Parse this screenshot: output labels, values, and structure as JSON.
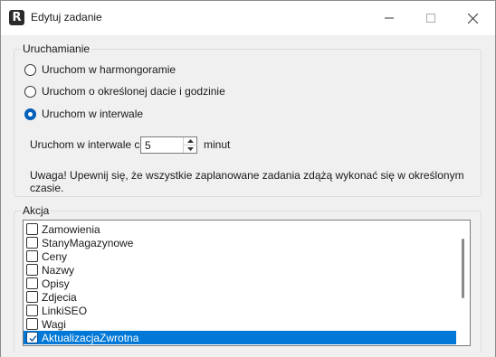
{
  "window": {
    "title": "Edytuj zadanie",
    "app_icon_letter": "R"
  },
  "launch_group": {
    "legend": "Uruchamianie",
    "options": [
      {
        "label": "Uruchom w harmongoramie",
        "checked": false
      },
      {
        "label": "Uruchom o określonej dacie i godzinie",
        "checked": false
      },
      {
        "label": "Uruchom w interwale",
        "checked": true
      }
    ],
    "interval_label": "Uruchom w interwale co",
    "interval_value": "5",
    "interval_unit": "minut",
    "warning": "Uwaga! Upewnij się, że wszystkie zaplanowane zadania zdążą wykonać się w określonym czasie."
  },
  "action_group": {
    "legend": "Akcja",
    "items": [
      {
        "label": "Zamowienia",
        "checked": false,
        "selected": false
      },
      {
        "label": "StanyMagazynowe",
        "checked": false,
        "selected": false
      },
      {
        "label": "Ceny",
        "checked": false,
        "selected": false
      },
      {
        "label": "Nazwy",
        "checked": false,
        "selected": false
      },
      {
        "label": "Opisy",
        "checked": false,
        "selected": false
      },
      {
        "label": "Zdjecia",
        "checked": false,
        "selected": false
      },
      {
        "label": "LinkiSEO",
        "checked": false,
        "selected": false
      },
      {
        "label": "Wagi",
        "checked": false,
        "selected": false
      },
      {
        "label": "AktualizacjaZwrotna",
        "checked": true,
        "selected": true
      }
    ]
  },
  "colors": {
    "accent": "#005fb8",
    "selection": "#0078d7",
    "window_bg": "#f0f0f0"
  },
  "icons": {
    "minimize": "minimize-icon",
    "maximize": "maximize-icon",
    "close": "close-icon",
    "spin_up": "chevron-up-icon",
    "spin_down": "chevron-down-icon",
    "check": "check-icon"
  }
}
